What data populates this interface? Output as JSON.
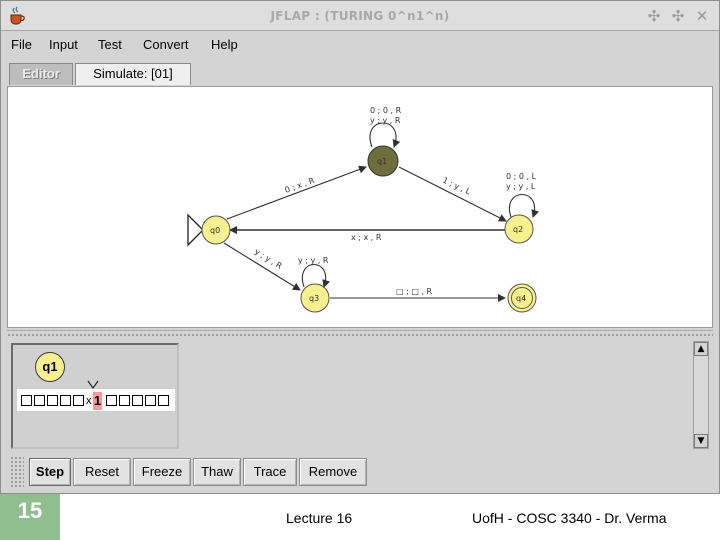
{
  "window": {
    "title": "JFLAP : (TURING 0^n1^n)"
  },
  "menu": [
    "File",
    "Input",
    "Test",
    "Convert",
    "Help"
  ],
  "tabs": [
    {
      "label": "Editor",
      "active": false
    },
    {
      "label": "Simulate: [01]",
      "active": true
    }
  ],
  "automaton": {
    "states": [
      {
        "id": "q0",
        "initial": true,
        "highlighted": false
      },
      {
        "id": "q1",
        "highlighted": true
      },
      {
        "id": "q2",
        "highlighted": false
      },
      {
        "id": "q3",
        "highlighted": false
      },
      {
        "id": "q4",
        "final": true,
        "highlighted": false
      }
    ],
    "transitions": [
      {
        "from": "q1",
        "to": "q1",
        "label1": "0 ; 0 , R",
        "label2": "y ; y , R"
      },
      {
        "from": "q0",
        "to": "q1",
        "label1": "0 ; x , R"
      },
      {
        "from": "q1",
        "to": "q2",
        "label1": "1 ; y , L"
      },
      {
        "from": "q2",
        "to": "q2",
        "label1": "0 ; 0 , L",
        "label2": "y ; y , L"
      },
      {
        "from": "q2",
        "to": "q0",
        "label1": "x ; x , R"
      },
      {
        "from": "q0",
        "to": "q3",
        "label1": "y ; y , R"
      },
      {
        "from": "q3",
        "to": "q3",
        "label1": "y ; y , R"
      },
      {
        "from": "q3",
        "to": "q4",
        "label1": "□ ; □ , R"
      }
    ]
  },
  "configuration": {
    "state": "q1",
    "tape_left_blanks": 5,
    "tape_left_symbol": "x",
    "head_symbol": "1",
    "tape_right_blanks": 5
  },
  "buttons": [
    "Step",
    "Reset",
    "Freeze",
    "Thaw",
    "Trace",
    "Remove"
  ],
  "footer": {
    "slide_number": "15",
    "center": "Lecture 16",
    "right": "UofH - COSC 3340 - Dr. Verma"
  },
  "colors": {
    "state_fill": "#f8f08e",
    "active_state_fill": "#6e6e3c",
    "head_cell": "#f49a9a",
    "slide_number_bg": "#8fbf8f"
  }
}
